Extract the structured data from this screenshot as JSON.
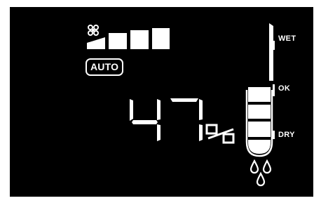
{
  "display": {
    "mode_badge": "AUTO",
    "fan": {
      "icon": "fan-icon",
      "speed_level": 4,
      "speed_max": 4
    },
    "humidity": {
      "value": "47",
      "unit": "%"
    },
    "gauge": {
      "scale_labels": [
        "WET",
        "OK",
        "DRY"
      ],
      "filled_segments": 3,
      "level_label": "DRY"
    },
    "drops_icon": "water-drops-icon"
  },
  "colors": {
    "background": "#000000",
    "segment": "#ffffff",
    "frame": "#ffffff"
  }
}
